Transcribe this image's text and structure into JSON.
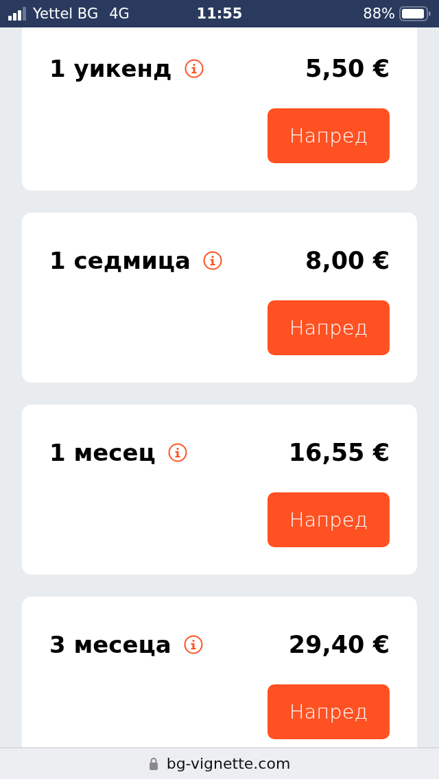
{
  "status_bar": {
    "carrier": "Yettel BG",
    "network": "4G",
    "time": "11:55",
    "battery": "88%"
  },
  "vignettes": [
    {
      "title": "1 уикенд",
      "price": "5,50 €",
      "button": "Напред"
    },
    {
      "title": "1 седмица",
      "price": "8,00 €",
      "button": "Напред"
    },
    {
      "title": "1 месец",
      "price": "16,55 €",
      "button": "Напред"
    },
    {
      "title": "3 месеца",
      "price": "29,40 €",
      "button": "Напред"
    }
  ],
  "address_bar": {
    "url": "bg-vignette.com"
  }
}
